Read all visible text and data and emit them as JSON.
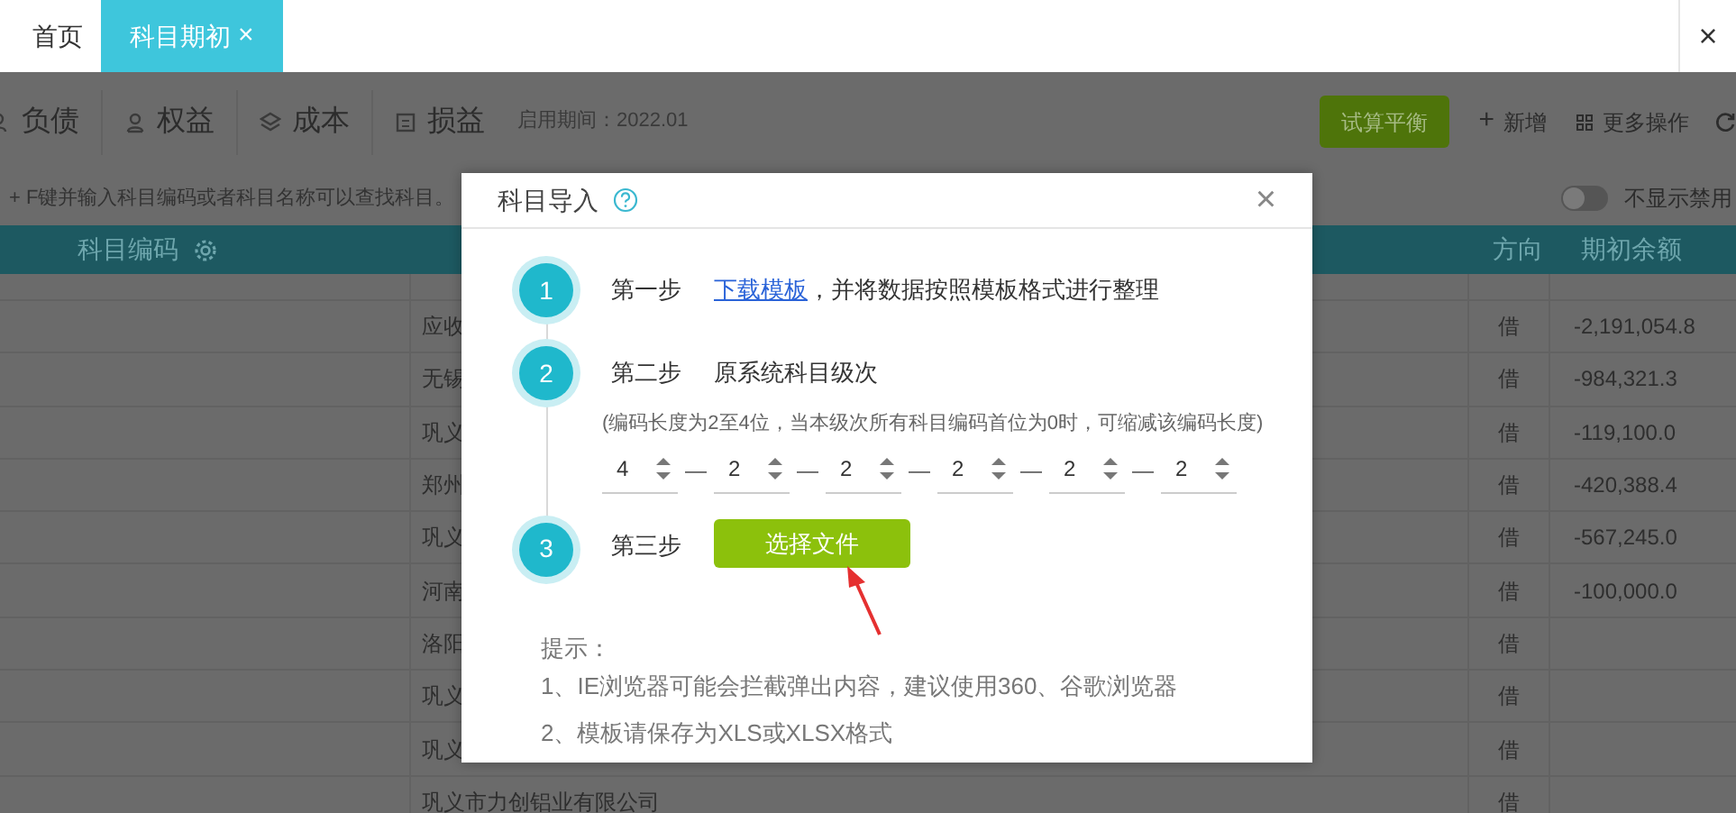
{
  "tabs": [
    {
      "label": "首页",
      "selected": false
    },
    {
      "label": "科目期初",
      "selected": true,
      "close": "×"
    }
  ],
  "window_close": "×",
  "categories": [
    {
      "label": "负债"
    },
    {
      "label": "权益"
    },
    {
      "label": "成本"
    },
    {
      "label": "损益"
    }
  ],
  "period": "启用期间：2022.01",
  "toolbar": [
    {
      "kind": "primary",
      "label": "试算平衡"
    },
    {
      "kind": "add",
      "glyph": "+",
      "label": "新增"
    },
    {
      "kind": "more",
      "label": "更多操作"
    },
    {
      "kind": "refresh"
    }
  ],
  "hint": "+ F键并输入科目编码或者科目名称可以查找科目。",
  "toggle": {
    "on": false,
    "label": "不显示禁用"
  },
  "table": {
    "columns": [
      {
        "kind": "code",
        "label": "科目编码"
      },
      {
        "kind": "direction",
        "label": "方向"
      },
      {
        "kind": "balance",
        "label": "期初余额"
      }
    ],
    "rows": [
      {
        "name": "应收",
        "direction": "借",
        "balance": "-2,191,054.8"
      },
      {
        "name": "无锡",
        "direction": "借",
        "balance": "-984,321.3"
      },
      {
        "name": "巩义",
        "direction": "借",
        "balance": "-119,100.0"
      },
      {
        "name": "郑州",
        "direction": "借",
        "balance": "-420,388.4"
      },
      {
        "name": "巩义",
        "direction": "借",
        "balance": "-567,245.0"
      },
      {
        "name": "河南",
        "direction": "借",
        "balance": "-100,000.0"
      },
      {
        "name": "洛阳",
        "direction": "借"
      },
      {
        "name": "巩义",
        "direction": "借"
      },
      {
        "name": "巩义",
        "direction": "借"
      },
      {
        "name": "巩义市力创铝业有限公司",
        "direction": "借"
      }
    ]
  },
  "dialog": {
    "title": "科目导入",
    "close": "×",
    "steps": [
      {
        "kind": "link",
        "number": "1",
        "label": "第一步",
        "link": "下载模板",
        "text": "，并将数据按照模板格式进行整理"
      },
      {
        "kind": "levels",
        "number": "2",
        "label": "第二步",
        "text": "原系统科目级次",
        "note": "(编码长度为2至4位，当本级次所有科目编码首位为0时，可缩减该编码长度)",
        "levels": [
          {
            "value": "4"
          },
          {
            "separator": "—",
            "value": "2"
          },
          {
            "separator": "—",
            "value": "2"
          },
          {
            "separator": "—",
            "value": "2"
          },
          {
            "separator": "—",
            "value": "2"
          },
          {
            "separator": "—",
            "value": "2"
          }
        ]
      },
      {
        "kind": "upload",
        "number": "3",
        "label": "第三步",
        "button": "选择文件"
      }
    ],
    "tips_title": "提示：",
    "tips": [
      "1、IE浏览器可能会拦截弹出内容，建议使用360、谷歌浏览器",
      "2、模板请保存为XLS或XLSX格式"
    ]
  }
}
